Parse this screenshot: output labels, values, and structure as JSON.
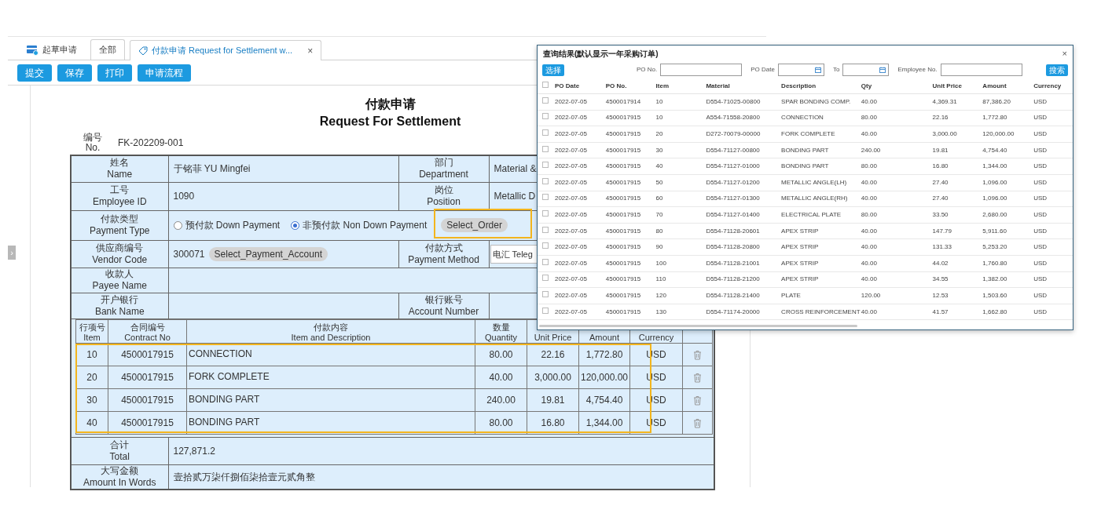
{
  "tabs": [
    {
      "kind": "home",
      "label": "起草申请",
      "selected": false
    },
    {
      "kind": "plain",
      "label": "全部",
      "selected": false
    },
    {
      "kind": "document",
      "label": "付款申请 Request for Settlement w...",
      "close": "×",
      "selected": true
    }
  ],
  "toolbar": [
    "提交",
    "保存",
    "打印",
    "申请流程"
  ],
  "collapse_handle": "›",
  "form": {
    "title_cn": "付款申请",
    "title_en": "Request For Settlement",
    "number_label": "编号\nNo.",
    "number_value": "FK-202209-001",
    "rows": [
      {
        "kind": "pair",
        "label": "姓名\nName",
        "value": "于铭菲 YU Mingfei",
        "label2": "部门\nDepartment",
        "value2": "Material &"
      },
      {
        "kind": "pair",
        "label": "工号\nEmployee ID",
        "value": "1090",
        "label2": "岗位\nPosition",
        "value2": "Metallic D"
      },
      {
        "kind": "radio",
        "label": "付款类型\nPayment Type",
        "options": [
          {
            "label": "预付款 Down Payment",
            "selected": false
          },
          {
            "label": "非预付款 Non Down Payment",
            "selected": true
          }
        ],
        "button": "Select_Order",
        "highlighted": true
      },
      {
        "kind": "vendor",
        "label": "供应商编号\nVendor Code",
        "value": "300071",
        "button": "Select_Payment_Account",
        "label2": "付款方式\nPayment Method",
        "select_value": "电汇 Teleg"
      },
      {
        "kind": "wide",
        "label": "收款人\nPayee Name"
      },
      {
        "kind": "pair",
        "label": "开户银行\nBank Name",
        "label2": "银行账号\nAccount Number"
      }
    ],
    "items": {
      "highlighted": true,
      "columns": [
        "行项号\nItem",
        "合同编号\nContract No",
        "付款内容\nItem and Description",
        "数量\nQuantity",
        "Unit Price",
        "Amount",
        "Currency"
      ],
      "rows": [
        {
          "item": "10",
          "contract": "4500017915",
          "description": "CONNECTION",
          "quantity": "80.00",
          "unit_price": "22.16",
          "amount": "1,772.80",
          "currency": "USD"
        },
        {
          "item": "20",
          "contract": "4500017915",
          "description": "FORK COMPLETE",
          "quantity": "40.00",
          "unit_price": "3,000.00",
          "amount": "120,000.00",
          "currency": "USD"
        },
        {
          "item": "30",
          "contract": "4500017915",
          "description": "BONDING PART",
          "quantity": "240.00",
          "unit_price": "19.81",
          "amount": "4,754.40",
          "currency": "USD"
        },
        {
          "item": "40",
          "contract": "4500017915",
          "description": "BONDING PART",
          "quantity": "80.00",
          "unit_price": "16.80",
          "amount": "1,344.00",
          "currency": "USD"
        }
      ]
    },
    "total": {
      "label": "合计\nTotal",
      "value": "127,871.2"
    },
    "amount_in_words": {
      "label": "大写金额\nAmount In Words",
      "value": "壹拾贰万柒仟捌佰柒拾壹元贰角整"
    }
  },
  "dialog": {
    "title": "查询结果(默认显示一年采购订单)",
    "close": "×",
    "select_button": "选择",
    "search_button": "搜索",
    "filters": [
      {
        "label": "PO No.",
        "kind": "text"
      },
      {
        "label": "PO Date",
        "kind": "date"
      },
      {
        "label": "To",
        "kind": "date"
      },
      {
        "label": "Employee No.",
        "kind": "text"
      }
    ],
    "header_checked": false,
    "columns": [
      "PO Date",
      "PO No.",
      "Item",
      "Material",
      "Description",
      "Qty",
      "Unit Price",
      "Amount",
      "Currency"
    ],
    "rows": [
      {
        "checked": false,
        "cells": [
          "2022-07-05",
          "4500017914",
          "10",
          "D554-71025-00800",
          "SPAR BONDING COMP.",
          "40.00",
          "4,369.31",
          "87,386.20",
          "USD"
        ]
      },
      {
        "checked": false,
        "cells": [
          "2022-07-05",
          "4500017915",
          "10",
          "A554-71558-20800",
          "CONNECTION",
          "80.00",
          "22.16",
          "1,772.80",
          "USD"
        ]
      },
      {
        "checked": false,
        "cells": [
          "2022-07-05",
          "4500017915",
          "20",
          "D272-70079-00000",
          "FORK COMPLETE",
          "40.00",
          "3,000.00",
          "120,000.00",
          "USD"
        ]
      },
      {
        "checked": false,
        "cells": [
          "2022-07-05",
          "4500017915",
          "30",
          "D554-71127-00800",
          "BONDING PART",
          "240.00",
          "19.81",
          "4,754.40",
          "USD"
        ]
      },
      {
        "checked": false,
        "cells": [
          "2022-07-05",
          "4500017915",
          "40",
          "D554-71127-01000",
          "BONDING PART",
          "80.00",
          "16.80",
          "1,344.00",
          "USD"
        ]
      },
      {
        "checked": false,
        "cells": [
          "2022-07-05",
          "4500017915",
          "50",
          "D554-71127-01200",
          "METALLIC ANGLE(LH)",
          "40.00",
          "27.40",
          "1,096.00",
          "USD"
        ]
      },
      {
        "checked": false,
        "cells": [
          "2022-07-05",
          "4500017915",
          "60",
          "D554-71127-01300",
          "METALLIC ANGLE(RH)",
          "40.00",
          "27.40",
          "1,096.00",
          "USD"
        ]
      },
      {
        "checked": false,
        "cells": [
          "2022-07-05",
          "4500017915",
          "70",
          "D554-71127-01400",
          "ELECTRICAL PLATE",
          "80.00",
          "33.50",
          "2,680.00",
          "USD"
        ]
      },
      {
        "checked": false,
        "cells": [
          "2022-07-05",
          "4500017915",
          "80",
          "D554-71128-20601",
          "APEX STRIP",
          "40.00",
          "147.79",
          "5,911.60",
          "USD"
        ]
      },
      {
        "checked": false,
        "cells": [
          "2022-07-05",
          "4500017915",
          "90",
          "D554-71128-20800",
          "APEX STRIP",
          "40.00",
          "131.33",
          "5,253.20",
          "USD"
        ]
      },
      {
        "checked": false,
        "cells": [
          "2022-07-05",
          "4500017915",
          "100",
          "D554-71128-21001",
          "APEX STRIP",
          "40.00",
          "44.02",
          "1,760.80",
          "USD"
        ]
      },
      {
        "checked": false,
        "cells": [
          "2022-07-05",
          "4500017915",
          "110",
          "D554-71128-21200",
          "APEX STRIP",
          "40.00",
          "34.55",
          "1,382.00",
          "USD"
        ]
      },
      {
        "checked": false,
        "cells": [
          "2022-07-05",
          "4500017915",
          "120",
          "D554-71128-21400",
          "PLATE",
          "120.00",
          "12.53",
          "1,503.60",
          "USD"
        ]
      },
      {
        "checked": false,
        "cells": [
          "2022-07-05",
          "4500017915",
          "130",
          "D554-71174-20000",
          "CROSS REINFORCEMENT",
          "40.00",
          "41.57",
          "1,662.80",
          "USD"
        ]
      }
    ]
  }
}
